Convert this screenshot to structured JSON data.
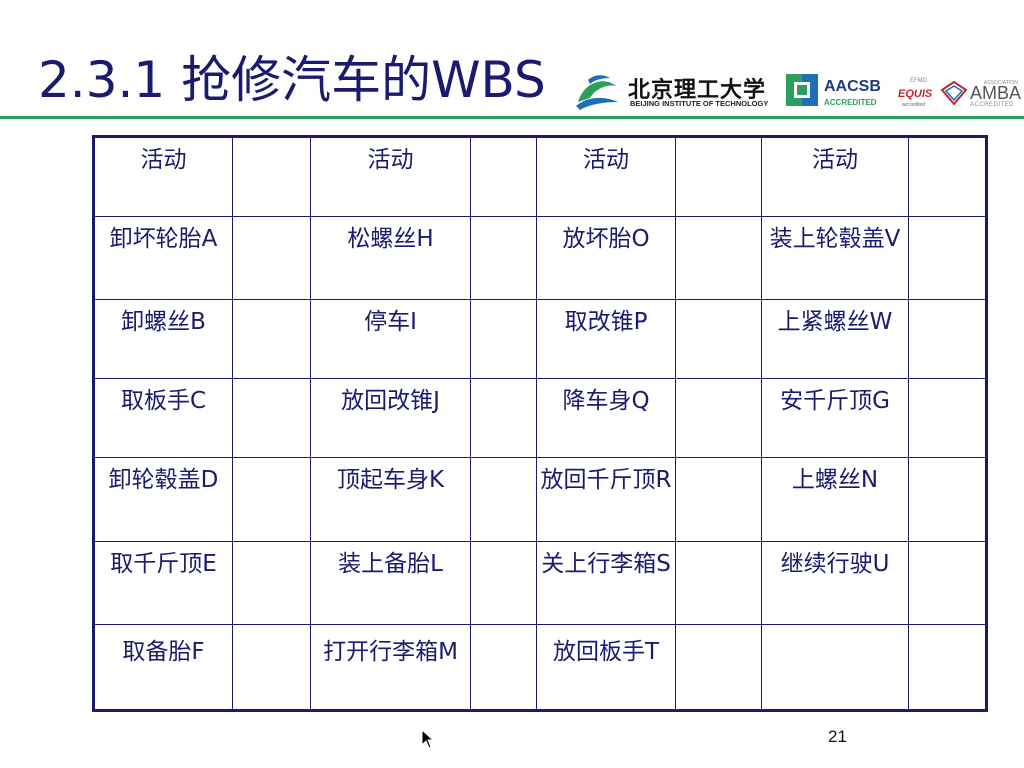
{
  "slide": {
    "title": "2.3.1 抢修汽车的WBS",
    "page_number": "21"
  },
  "logos": {
    "bit_cn": "北京理工大学",
    "bit_en": "BEIJING INSTITUTE OF TECHNOLOGY",
    "aacsb": "AACSB",
    "aacsb_sub": "ACCREDITED",
    "efmd": "EFMD",
    "equis": "EQUIS",
    "equis_sub": "accredited",
    "amba_assoc": "ASSOCIATION",
    "amba": "AMBA",
    "amba_sub": "ACCREDITED"
  },
  "table": {
    "header": [
      "活动",
      "",
      "活动",
      "",
      "活动",
      "",
      "活动",
      ""
    ],
    "rows": [
      [
        "卸坏轮胎A",
        "",
        "松螺丝H",
        "",
        "放坏胎O",
        "",
        "装上轮毂盖V",
        ""
      ],
      [
        "卸螺丝B",
        "",
        "停车I",
        "",
        "取改锥P",
        "",
        "上紧螺丝W",
        ""
      ],
      [
        "取板手C",
        "",
        "放回改锥J",
        "",
        "降车身Q",
        "",
        "安千斤顶G",
        ""
      ],
      [
        "卸轮毂盖D",
        "",
        "顶起车身K",
        "",
        "放回千斤顶R",
        "",
        "上螺丝N",
        ""
      ],
      [
        "取千斤顶E",
        "",
        "装上备胎L",
        "",
        "关上行李箱S",
        "",
        "继续行驶U",
        ""
      ],
      [
        "取备胎F",
        "",
        "打开行李箱M",
        "",
        "放回板手T",
        "",
        "",
        ""
      ]
    ]
  },
  "colors": {
    "title": "#1a1a6e",
    "rule": "#2e9e5e",
    "table_border": "#1a1a6e"
  }
}
